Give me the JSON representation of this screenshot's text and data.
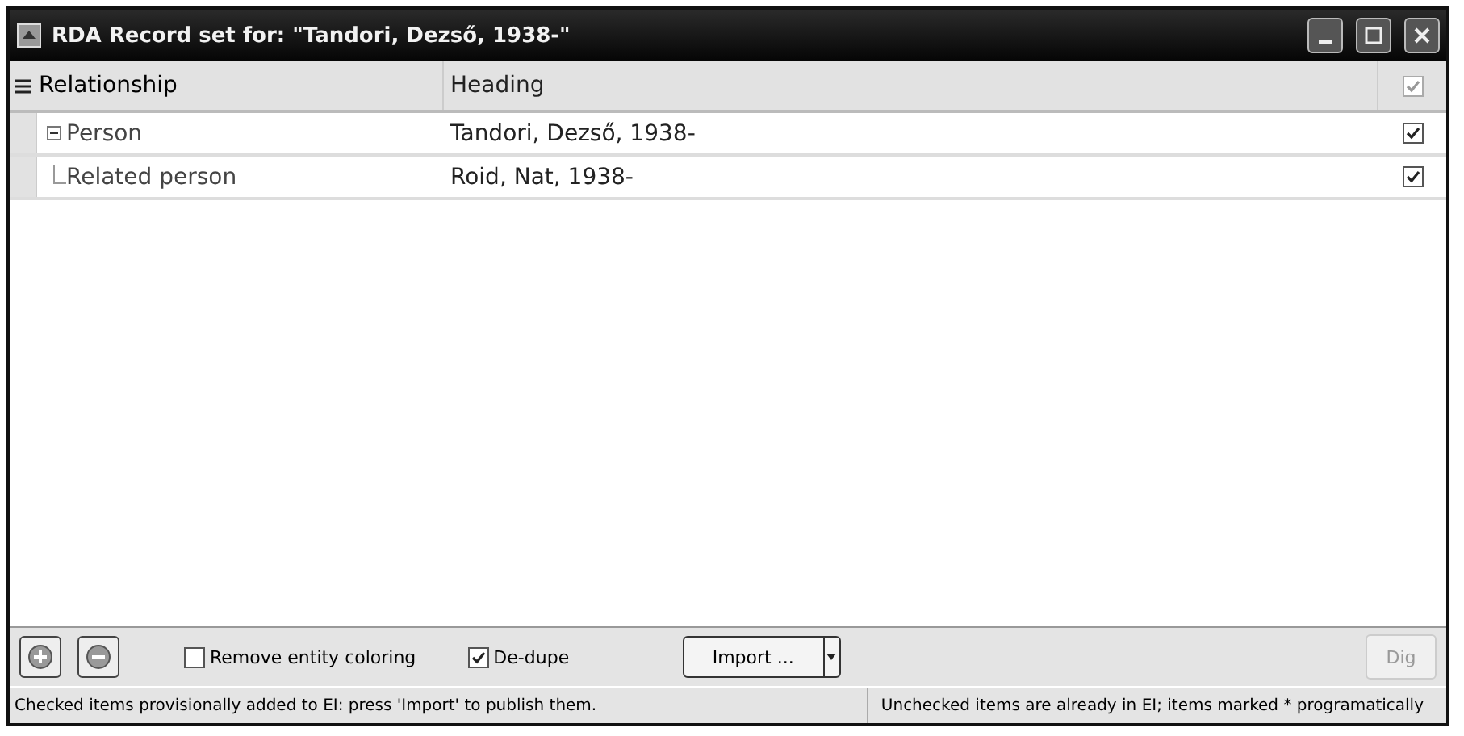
{
  "window": {
    "title": "RDA Record set for: \"Tandori, Dezső, 1938-\""
  },
  "table": {
    "columns": [
      "Relationship",
      "Heading"
    ],
    "header_check": {
      "checked": true,
      "disabled": true
    },
    "rows": [
      {
        "relationship": "Person",
        "heading": "Tandori, Dezső, 1938-",
        "checked": true,
        "expanded": true,
        "children": [
          {
            "relationship": "Related person",
            "heading": "Roid, Nat, 1938-",
            "checked": true
          }
        ]
      }
    ]
  },
  "toolbar": {
    "options": [
      {
        "label": "Remove entity coloring",
        "checked": false
      },
      {
        "label": "De-dupe",
        "checked": true
      }
    ],
    "import_button": "Import ...",
    "dig_button": {
      "label": "Dig",
      "disabled": true
    }
  },
  "status_bar": [
    "Checked items provisionally added to EI: press 'Import' to publish them.",
    "Unchecked items are already in EI; items marked * programatically"
  ]
}
